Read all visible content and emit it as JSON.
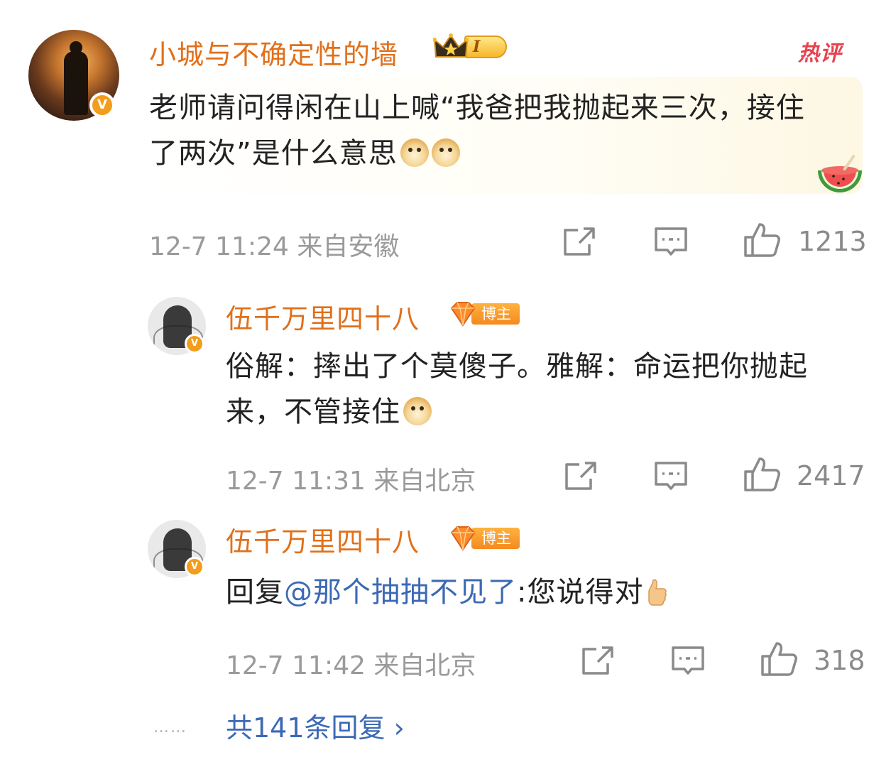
{
  "main_comment": {
    "username": "小城与不确定性的墙",
    "level_badge": "I",
    "hot_label": "热评",
    "content": "老师请问得闲在山上喊“我爸把我抛起来三次，接住了两次”是什么意思",
    "emojis": [
      "doge-emoji",
      "doge-emoji"
    ],
    "time": "12-7 11:24",
    "location": "来自安徽",
    "like_count": "1213",
    "verified": "V"
  },
  "replies": [
    {
      "username": "伍千万里四十八",
      "role_badge": "博主",
      "content": "俗解：摔出了个莫傻子。雅解：命运把你抛起来，不管接住",
      "emoji": "doge-emoji",
      "time": "12-7 11:31",
      "location": "来自北京",
      "like_count": "2417",
      "verified": "V"
    },
    {
      "username": "伍千万里四十八",
      "role_badge": "博主",
      "reply_prefix": "回复",
      "mention": "@那个抽抽不见了",
      "content": ":您说得对",
      "emoji": "thumbs-up-emoji",
      "time": "12-7 11:42",
      "location": "来自北京",
      "like_count": "318",
      "verified": "V"
    }
  ],
  "more_replies": {
    "dots": "……",
    "label": "共141条回复",
    "arrow": "›"
  },
  "colors": {
    "username": "#e0701b",
    "meta": "#9a9a9a",
    "link": "#3c69b5",
    "hot": "#e8424f",
    "verified": "#f29d1b"
  }
}
